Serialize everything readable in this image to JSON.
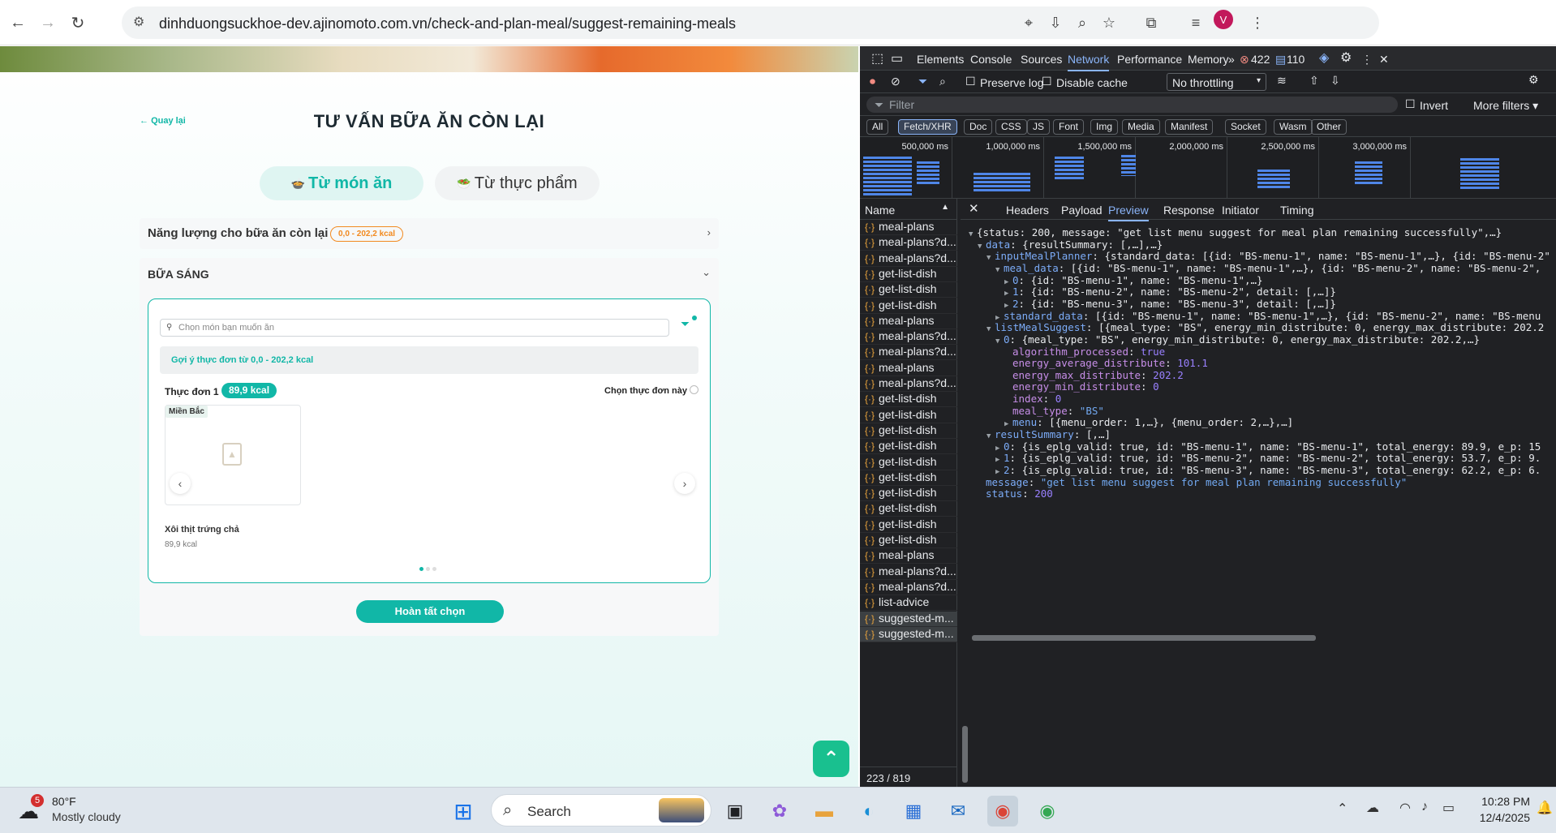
{
  "browser": {
    "url": "dinhduongsuckhoe-dev.ajinomoto.com.vn/check-and-plan-meal/suggest-remaining-meals",
    "profile_initial": "V"
  },
  "page": {
    "back_label": "Quay lại",
    "title": "TƯ VẤN BỮA ĂN CÒN LẠI",
    "tab_dish": "Từ món ăn",
    "tab_food": "Từ thực phẩm",
    "energy_label": "Năng lượng cho bữa ăn còn lại",
    "energy_range": "0,0 - 202,2 kcal",
    "breakfast_label": "BỮA SÁNG",
    "search_placeholder": "Chọn món bạn muốn ăn",
    "suggest_text": "Gợi ý thực đơn từ 0,0 - 202,2 kcal",
    "menu_label": "Thực đơn 1",
    "menu_kcal": "89,9 kcal",
    "choose_label": "Chọn thực đơn này",
    "region": "Miền Bắc",
    "dish_name": "Xôi thịt trứng chả",
    "dish_kcal": "89,9 kcal",
    "done_button": "Hoàn tất chọn",
    "carousel_pages": 3,
    "carousel_active": 1
  },
  "devtools": {
    "tabs": [
      "Elements",
      "Console",
      "Sources",
      "Network",
      "Performance",
      "Memory"
    ],
    "active_tab": "Network",
    "error_count": "422",
    "message_count": "110",
    "preserve_log": "Preserve log",
    "disable_cache": "Disable cache",
    "throttling": "No throttling",
    "filter_placeholder": "Filter",
    "invert": "Invert",
    "more_filters": "More filters",
    "type_filters": [
      "All",
      "Fetch/XHR",
      "Doc",
      "CSS",
      "JS",
      "Font",
      "Img",
      "Media",
      "Manifest",
      "Socket",
      "Wasm",
      "Other"
    ],
    "active_type": "Fetch/XHR",
    "timeline_ticks": [
      "500,000 ms",
      "1,000,000 ms",
      "1,500,000 ms",
      "2,000,000 ms",
      "2,500,000 ms",
      "3,000,000 ms"
    ],
    "name_header": "Name",
    "requests": [
      "meal-plans",
      "meal-plans?d...",
      "meal-plans?d...",
      "get-list-dish",
      "get-list-dish",
      "get-list-dish",
      "meal-plans",
      "meal-plans?d...",
      "meal-plans?d...",
      "meal-plans",
      "meal-plans?d...",
      "get-list-dish",
      "get-list-dish",
      "get-list-dish",
      "get-list-dish",
      "get-list-dish",
      "get-list-dish",
      "get-list-dish",
      "get-list-dish",
      "get-list-dish",
      "get-list-dish",
      "meal-plans",
      "meal-plans?d...",
      "meal-plans?d...",
      "list-advice",
      "suggested-m...",
      "suggested-m..."
    ],
    "request_count": "223 / 819 requests",
    "preview_tabs": [
      "Headers",
      "Payload",
      "Preview",
      "Response",
      "Initiator",
      "Timing"
    ],
    "active_preview": "Preview",
    "json_lines": [
      {
        "d": 0,
        "t": "▼",
        "k": "",
        "v": "{status: 200, message: \"get list menu suggest for meal plan remaining successfully\",…}",
        "c": "plain"
      },
      {
        "d": 1,
        "t": "▼",
        "k": "data",
        "v": "{resultSummary: [,…],…}",
        "c": "plain"
      },
      {
        "d": 2,
        "t": "▼",
        "k": "inputMealPlanner",
        "v": "{standard_data: [{id: \"BS-menu-1\", name: \"BS-menu-1\",…}, {id: \"BS-menu-2\"",
        "c": "plain"
      },
      {
        "d": 3,
        "t": "▼",
        "k": "meal_data",
        "v": "[{id: \"BS-menu-1\", name: \"BS-menu-1\",…}, {id: \"BS-menu-2\", name: \"BS-menu-2\",",
        "c": "plain"
      },
      {
        "d": 4,
        "t": "▶",
        "k": "0",
        "v": "{id: \"BS-menu-1\", name: \"BS-menu-1\",…}",
        "c": "plain"
      },
      {
        "d": 4,
        "t": "▶",
        "k": "1",
        "v": "{id: \"BS-menu-2\", name: \"BS-menu-2\", detail: [,…]}",
        "c": "plain"
      },
      {
        "d": 4,
        "t": "▶",
        "k": "2",
        "v": "{id: \"BS-menu-3\", name: \"BS-menu-3\", detail: [,…]}",
        "c": "plain"
      },
      {
        "d": 3,
        "t": "▶",
        "k": "standard_data",
        "v": "[{id: \"BS-menu-1\", name: \"BS-menu-1\",…}, {id: \"BS-menu-2\", name: \"BS-menu",
        "c": "plain"
      },
      {
        "d": 2,
        "t": "▼",
        "k": "listMealSuggest",
        "v": "[{meal_type: \"BS\", energy_min_distribute: 0, energy_max_distribute: 202.2",
        "c": "plain"
      },
      {
        "d": 3,
        "t": "▼",
        "k": "0",
        "v": "{meal_type: \"BS\", energy_min_distribute: 0, energy_max_distribute: 202.2,…}",
        "c": "plain"
      },
      {
        "d": 4,
        "t": "",
        "k": "algorithm_processed",
        "v": "true",
        "c": "b"
      },
      {
        "d": 4,
        "t": "",
        "k": "energy_average_distribute",
        "v": "101.1",
        "c": "n"
      },
      {
        "d": 4,
        "t": "",
        "k": "energy_max_distribute",
        "v": "202.2",
        "c": "n"
      },
      {
        "d": 4,
        "t": "",
        "k": "energy_min_distribute",
        "v": "0",
        "c": "n"
      },
      {
        "d": 4,
        "t": "",
        "k": "index",
        "v": "0",
        "c": "n"
      },
      {
        "d": 4,
        "t": "",
        "k": "meal_type",
        "v": "\"BS\"",
        "c": "s"
      },
      {
        "d": 4,
        "t": "▶",
        "k": "menu",
        "v": "[{menu_order: 1,…}, {menu_order: 2,…},…]",
        "c": "plain"
      },
      {
        "d": 2,
        "t": "▼",
        "k": "resultSummary",
        "v": "[,…]",
        "c": "plain"
      },
      {
        "d": 3,
        "t": "▶",
        "k": "0",
        "v": "{is_eplg_valid: true, id: \"BS-menu-1\", name: \"BS-menu-1\", total_energy: 89.9, e_p: 15",
        "c": "plain"
      },
      {
        "d": 3,
        "t": "▶",
        "k": "1",
        "v": "{is_eplg_valid: true, id: \"BS-menu-2\", name: \"BS-menu-2\", total_energy: 53.7, e_p: 9.",
        "c": "plain"
      },
      {
        "d": 3,
        "t": "▶",
        "k": "2",
        "v": "{is_eplg_valid: true, id: \"BS-menu-3\", name: \"BS-menu-3\", total_energy: 62.2, e_p: 6.",
        "c": "plain"
      },
      {
        "d": 1,
        "t": "",
        "k": "message",
        "v": "\"get list menu suggest for meal plan remaining successfully\"",
        "c": "s"
      },
      {
        "d": 1,
        "t": "",
        "k": "status",
        "v": "200",
        "c": "n"
      }
    ]
  },
  "taskbar": {
    "weather_temp": "80°F",
    "weather_desc": "Mostly cloudy",
    "weather_badge": "5",
    "search_placeholder": "Search",
    "time": "10:28 PM",
    "date": "12/4/2025"
  }
}
